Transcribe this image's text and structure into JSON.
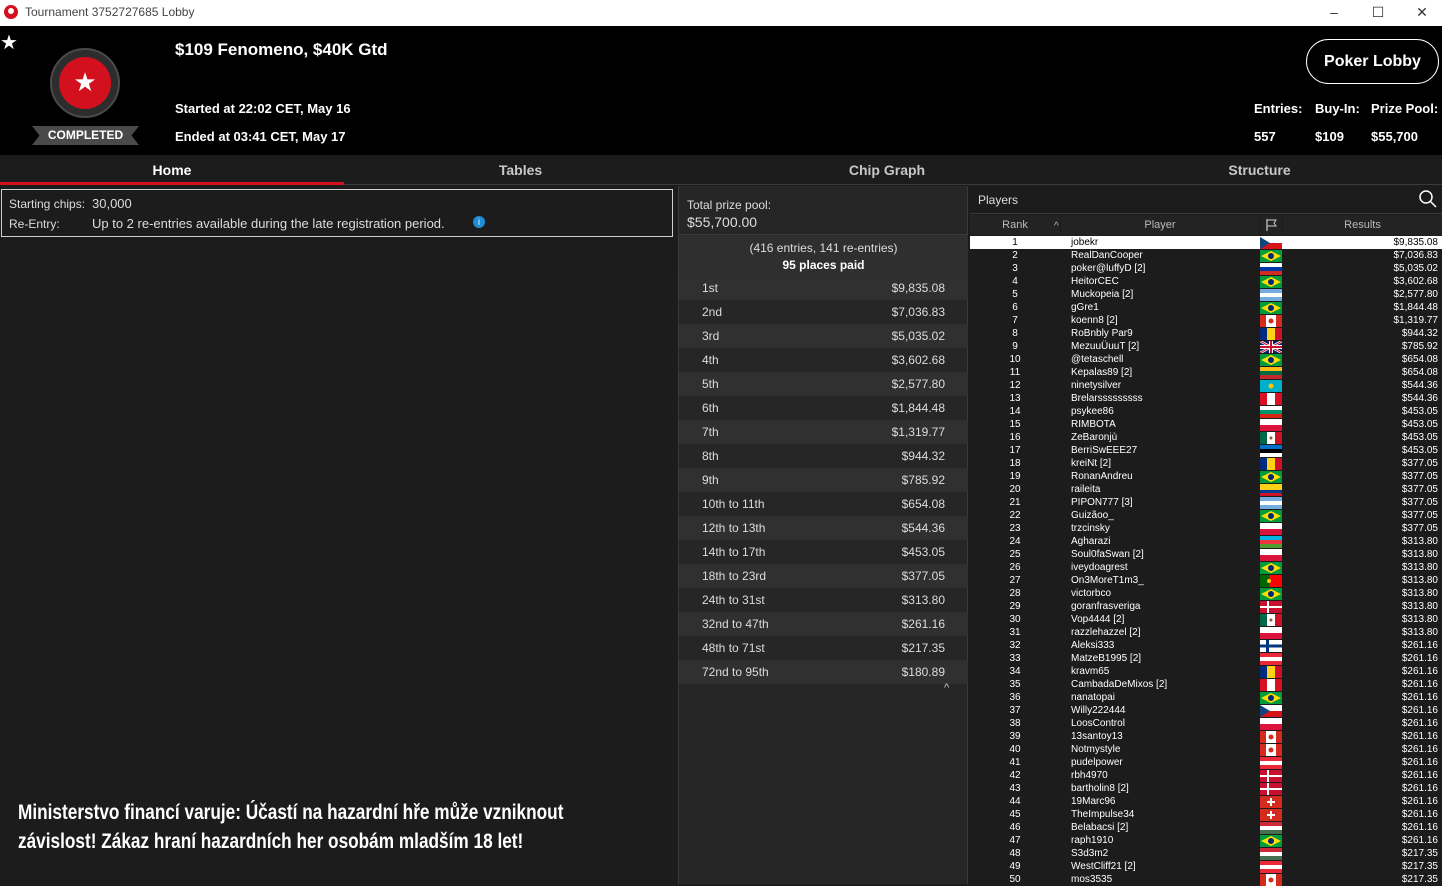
{
  "window": {
    "title": "Tournament 3752727685 Lobby",
    "minimize": "–",
    "maximize": "☐",
    "close": "✕",
    "icon": "pokerstars-icon"
  },
  "header": {
    "favorite": "★",
    "logo": "★",
    "status": "COMPLETED",
    "name": "$109 Fenomeno, $40K Gtd",
    "started": "Started at 22:02 CET, May 16",
    "ended": "Ended at 03:41 CET, May 17",
    "lobby_button": "Poker Lobby",
    "entries_label": "Entries:",
    "entries": "557",
    "buyin_label": "Buy-In:",
    "buyin": "$109",
    "pool_label": "Prize Pool:",
    "pool": "$55,700"
  },
  "tabs": [
    "Home",
    "Tables",
    "Chip Graph",
    "Structure"
  ],
  "info": {
    "chips_label": "Starting chips:",
    "chips": "30,000",
    "reentry_label": "Re-Entry:",
    "reentry": "Up to 2 re-entries available during the late registration period.",
    "info_icon": "i"
  },
  "warning": [
    "Ministerstvo financí varuje: Účastí na hazardní hře může vzniknout",
    "závislost! Zákaz hraní hazardních her osobám mladším 18 let!"
  ],
  "prize": {
    "label": "Total prize pool:",
    "total": "$55,700.00",
    "entries": "(416 entries, 141 re-entries)",
    "paid": "95 places paid",
    "rows": [
      {
        "place": "1st",
        "amount": "$9,835.08"
      },
      {
        "place": "2nd",
        "amount": "$7,036.83"
      },
      {
        "place": "3rd",
        "amount": "$5,035.02"
      },
      {
        "place": "4th",
        "amount": "$3,602.68"
      },
      {
        "place": "5th",
        "amount": "$2,577.80"
      },
      {
        "place": "6th",
        "amount": "$1,844.48"
      },
      {
        "place": "7th",
        "amount": "$1,319.77"
      },
      {
        "place": "8th",
        "amount": "$944.32"
      },
      {
        "place": "9th",
        "amount": "$785.92"
      },
      {
        "place": "10th to 11th",
        "amount": "$654.08"
      },
      {
        "place": "12th to 13th",
        "amount": "$544.36"
      },
      {
        "place": "14th to 17th",
        "amount": "$453.05"
      },
      {
        "place": "18th to 23rd",
        "amount": "$377.05"
      },
      {
        "place": "24th to 31st",
        "amount": "$313.80"
      },
      {
        "place": "32nd to 47th",
        "amount": "$261.16"
      },
      {
        "place": "48th to 71st",
        "amount": "$217.35"
      },
      {
        "place": "72nd to 95th",
        "amount": "$180.89"
      }
    ],
    "collapse": "^"
  },
  "players": {
    "title": "Players",
    "search_icon": "search-icon",
    "columns": {
      "rank": "Rank",
      "sort": "^",
      "player": "Player",
      "flag": "flag-icon",
      "results": "Results"
    },
    "rows": [
      {
        "rank": "1",
        "name": "jobekr",
        "flag": "cz",
        "result": "$9,835.08"
      },
      {
        "rank": "2",
        "name": "RealDanCooper",
        "flag": "br",
        "result": "$7,036.83"
      },
      {
        "rank": "3",
        "name": "poker@luffyD [2]",
        "flag": "ru",
        "result": "$5,035.02"
      },
      {
        "rank": "4",
        "name": "HeitorCEC",
        "flag": "br",
        "result": "$3,602.68"
      },
      {
        "rank": "5",
        "name": "Muckopeia [2]",
        "flag": "ar",
        "result": "$2,577.80"
      },
      {
        "rank": "6",
        "name": "gGre1",
        "flag": "br",
        "result": "$1,844.48"
      },
      {
        "rank": "7",
        "name": "koenn8 [2]",
        "flag": "ca",
        "result": "$1,319.77"
      },
      {
        "rank": "8",
        "name": "RoBnbly Par9",
        "flag": "ro",
        "result": "$944.32"
      },
      {
        "rank": "9",
        "name": "MezuuÜuuT [2]",
        "flag": "gb",
        "result": "$785.92"
      },
      {
        "rank": "10",
        "name": "@tetaschell",
        "flag": "br",
        "result": "$654.08"
      },
      {
        "rank": "11",
        "name": "Kepalas89 [2]",
        "flag": "lt",
        "result": "$654.08"
      },
      {
        "rank": "12",
        "name": "ninetysilver",
        "flag": "kz",
        "result": "$544.36"
      },
      {
        "rank": "13",
        "name": "Brelarsssssssss",
        "flag": "pe",
        "result": "$544.36"
      },
      {
        "rank": "14",
        "name": "psykee86",
        "flag": "bg",
        "result": "$453.05"
      },
      {
        "rank": "15",
        "name": "RIMBOTA",
        "flag": "pl",
        "result": "$453.05"
      },
      {
        "rank": "16",
        "name": "ZeBaronjù",
        "flag": "mx",
        "result": "$453.05"
      },
      {
        "rank": "17",
        "name": "BerriSwEEE27",
        "flag": "ee",
        "result": "$453.05"
      },
      {
        "rank": "18",
        "name": "kreiNt [2]",
        "flag": "ro",
        "result": "$377.05"
      },
      {
        "rank": "19",
        "name": "RonanAndreu",
        "flag": "br",
        "result": "$377.05"
      },
      {
        "rank": "20",
        "name": "raileita",
        "flag": "co",
        "result": "$377.05"
      },
      {
        "rank": "21",
        "name": "PIPON777 [3]",
        "flag": "ar",
        "result": "$377.05"
      },
      {
        "rank": "22",
        "name": "Guizãoo_",
        "flag": "br",
        "result": "$377.05"
      },
      {
        "rank": "23",
        "name": "trzcinsky",
        "flag": "pl",
        "result": "$377.05"
      },
      {
        "rank": "24",
        "name": "Agharazi",
        "flag": "az",
        "result": "$313.80"
      },
      {
        "rank": "25",
        "name": "Soul0faSwan [2]",
        "flag": "pl",
        "result": "$313.80"
      },
      {
        "rank": "26",
        "name": "iveydoagrest",
        "flag": "br",
        "result": "$313.80"
      },
      {
        "rank": "27",
        "name": "On3MoreT1m3_",
        "flag": "pt",
        "result": "$313.80"
      },
      {
        "rank": "28",
        "name": "victorbco",
        "flag": "br",
        "result": "$313.80"
      },
      {
        "rank": "29",
        "name": "goranfrasveriga",
        "flag": "dk",
        "result": "$313.80"
      },
      {
        "rank": "30",
        "name": "Vop4444 [2]",
        "flag": "mx",
        "result": "$313.80"
      },
      {
        "rank": "31",
        "name": "razzlehazzel [2]",
        "flag": "pl",
        "result": "$313.80"
      },
      {
        "rank": "32",
        "name": "Aleksi333",
        "flag": "fi",
        "result": "$261.16"
      },
      {
        "rank": "33",
        "name": "MatzeB1995 [2]",
        "flag": "at",
        "result": "$261.16"
      },
      {
        "rank": "34",
        "name": "kravm65",
        "flag": "ro",
        "result": "$261.16"
      },
      {
        "rank": "35",
        "name": "CambadaDeMixos [2]",
        "flag": "pe",
        "result": "$261.16"
      },
      {
        "rank": "36",
        "name": "nanatopai",
        "flag": "br",
        "result": "$261.16"
      },
      {
        "rank": "37",
        "name": "Willy222444",
        "flag": "cz",
        "result": "$261.16"
      },
      {
        "rank": "38",
        "name": "LoosControl",
        "flag": "pl",
        "result": "$261.16"
      },
      {
        "rank": "39",
        "name": "13santoy13",
        "flag": "ca",
        "result": "$261.16"
      },
      {
        "rank": "40",
        "name": "Notmystyle",
        "flag": "ca",
        "result": "$261.16"
      },
      {
        "rank": "41",
        "name": "pudelpower",
        "flag": "at",
        "result": "$261.16"
      },
      {
        "rank": "42",
        "name": "rbh4970",
        "flag": "dk",
        "result": "$261.16"
      },
      {
        "rank": "43",
        "name": "bartholin8 [2]",
        "flag": "dk",
        "result": "$261.16"
      },
      {
        "rank": "44",
        "name": "19Marc96",
        "flag": "ch",
        "result": "$261.16"
      },
      {
        "rank": "45",
        "name": "TheImpulse34",
        "flag": "ch",
        "result": "$261.16"
      },
      {
        "rank": "46",
        "name": "Belabacsi [2]",
        "flag": "hu",
        "result": "$261.16"
      },
      {
        "rank": "47",
        "name": "raph1910",
        "flag": "br",
        "result": "$261.16"
      },
      {
        "rank": "48",
        "name": "S3d3m2",
        "flag": "hu",
        "result": "$217.35"
      },
      {
        "rank": "49",
        "name": "WestCliff21 [2]",
        "flag": "at",
        "result": "$217.35"
      },
      {
        "rank": "50",
        "name": "mos3535",
        "flag": "ca",
        "result": "$217.35"
      }
    ]
  }
}
